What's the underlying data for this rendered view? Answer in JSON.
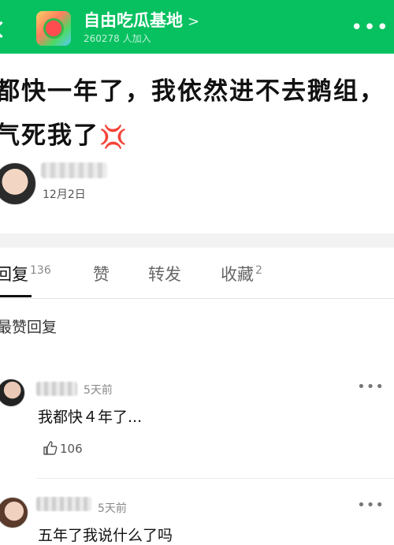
{
  "header": {
    "group_name": "自由吃瓜基地",
    "member_count": "260278 人加入",
    "icons": [
      "back-icon",
      "group-avatar",
      "chevron-right-icon",
      "more-icon"
    ]
  },
  "post": {
    "text": "都快一年了，我依然进不去鹅组，气死我了",
    "emoji": "angry-icon",
    "date": "12月2日"
  },
  "tabs": [
    {
      "label": "回复",
      "count": "136"
    },
    {
      "label": "赞",
      "count": ""
    },
    {
      "label": "转发",
      "count": ""
    },
    {
      "label": "收藏",
      "count": "2"
    }
  ],
  "sort_label": "最赞回复",
  "comments": [
    {
      "time": "5天前",
      "text": "我都快４年了...",
      "likes": "106"
    },
    {
      "time": "5天前",
      "text": "五年了我说什么了吗"
    }
  ],
  "colors": {
    "header_bg": "#07c160",
    "angry": "#e60012"
  }
}
